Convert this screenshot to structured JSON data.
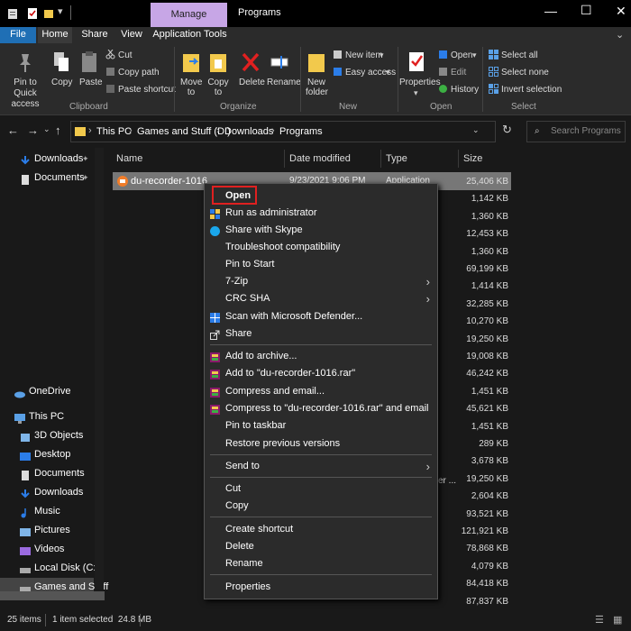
{
  "titlebar": {
    "manage_tab": "Manage",
    "window_title": "Programs",
    "minimize": "—",
    "maximize": "☐",
    "close": "✕"
  },
  "ribbon_tabs": [
    "File",
    "Home",
    "Share",
    "View",
    "Application Tools"
  ],
  "ribbon": {
    "pin": "Pin to Quick access",
    "copy": "Copy",
    "paste": "Paste",
    "cut": "Cut",
    "copy_path": "Copy path",
    "paste_shortcut": "Paste shortcut",
    "clipboard": "Clipboard",
    "move_to": "Move to",
    "copy_to": "Copy to",
    "delete": "Delete",
    "rename": "Rename",
    "organize": "Organize",
    "new_folder": "New folder",
    "new_item": "New item",
    "easy_access": "Easy access",
    "new": "New",
    "properties": "Properties",
    "open": "Open",
    "edit": "Edit",
    "history": "History",
    "open_group": "Open",
    "select_all": "Select all",
    "select_none": "Select none",
    "invert_selection": "Invert selection",
    "select": "Select"
  },
  "address": {
    "crumbs": [
      "This PC",
      "Games and Stuff (D:)",
      "Downloads",
      "Programs"
    ],
    "search_placeholder": "Search Programs"
  },
  "nav": {
    "quick": [
      "Downloads",
      "Documents"
    ],
    "onedrive": "OneDrive",
    "thispc": "This PC",
    "pc_items": [
      "3D Objects",
      "Desktop",
      "Documents",
      "Downloads",
      "Music",
      "Pictures",
      "Videos",
      "Local Disk (C:)",
      "Games and Stuff"
    ]
  },
  "columns": {
    "name": "Name",
    "date": "Date modified",
    "type": "Type",
    "size": "Size"
  },
  "selected_file": {
    "name": "du-recorder-1016",
    "date": "9/23/2021 9:06 PM",
    "type": "Application"
  },
  "partial_type": "er ...",
  "sizes": [
    "25,406 KB",
    "1,142 KB",
    "1,360 KB",
    "12,453 KB",
    "1,360 KB",
    "69,199 KB",
    "1,414 KB",
    "32,285 KB",
    "10,270 KB",
    "19,250 KB",
    "19,008 KB",
    "46,242 KB",
    "1,451 KB",
    "45,621 KB",
    "1,451 KB",
    "289 KB",
    "3,678 KB",
    "19,250 KB",
    "2,604 KB",
    "93,521 KB",
    "121,921 KB",
    "78,868 KB",
    "4,079 KB",
    "84,418 KB",
    "87,837 KB"
  ],
  "context_menu": {
    "open": "Open",
    "run_admin": "Run as administrator",
    "share_skype": "Share with Skype",
    "troubleshoot": "Troubleshoot compatibility",
    "pin_start": "Pin to Start",
    "zip7": "7-Zip",
    "crc": "CRC SHA",
    "defender": "Scan with Microsoft Defender...",
    "share": "Share",
    "add_archive": "Add to archive...",
    "add_rar": "Add to \"du-recorder-1016.rar\"",
    "compress_email": "Compress and email...",
    "compress_rar_email": "Compress to \"du-recorder-1016.rar\" and email",
    "pin_taskbar": "Pin to taskbar",
    "restore": "Restore previous versions",
    "send_to": "Send to",
    "cut": "Cut",
    "copy": "Copy",
    "create_shortcut": "Create shortcut",
    "delete": "Delete",
    "rename": "Rename",
    "properties": "Properties"
  },
  "status": {
    "items": "25 items",
    "selected": "1 item selected  24.8 MB"
  },
  "colors": {
    "accent_manage": "#c7a6e6",
    "highlight_red": "#e02020",
    "folder": "#f2c94c"
  }
}
